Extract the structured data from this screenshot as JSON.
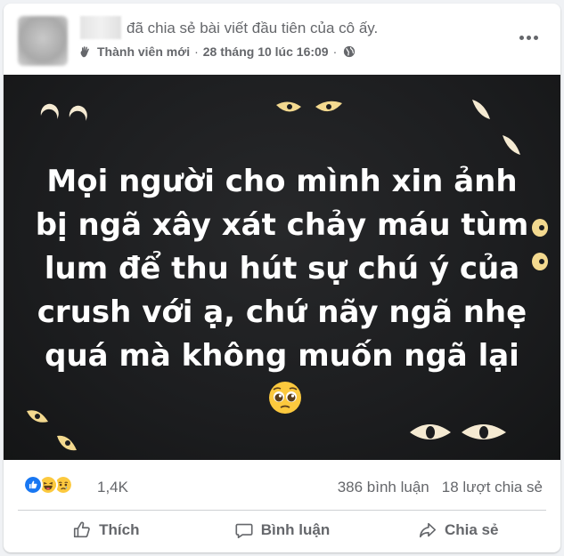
{
  "post": {
    "action_text": "đã chia sẻ bài viết đầu tiên của cô ấy.",
    "badge": "Thành viên mới",
    "separator": "·",
    "timestamp": "28 tháng 10 lúc 16:09",
    "image_text": "Mọi người cho mình xin ảnh bị ngã xây xát chảy máu tùm lum để thu hút sự chú ý của crush với ạ, chứ nãy ngã nhẹ quá mà không muốn ngã lại",
    "image_emoji": "pleading-face"
  },
  "stats": {
    "reaction_count": "1,4K",
    "comments": "386 bình luận",
    "shares": "18 lượt chia sẻ",
    "reaction_icons": [
      "like-icon",
      "haha-icon",
      "sad-icon"
    ]
  },
  "actions": {
    "like_label": "Thích",
    "comment_label": "Bình luận",
    "share_label": "Chia sẻ"
  },
  "colors": {
    "image_bg": "#1c1d1f",
    "eye_color": "#f3d98f",
    "secondary_text": "#65676b",
    "like_blue": "#1877f2",
    "emoji_yellow": "#fcc93e"
  }
}
